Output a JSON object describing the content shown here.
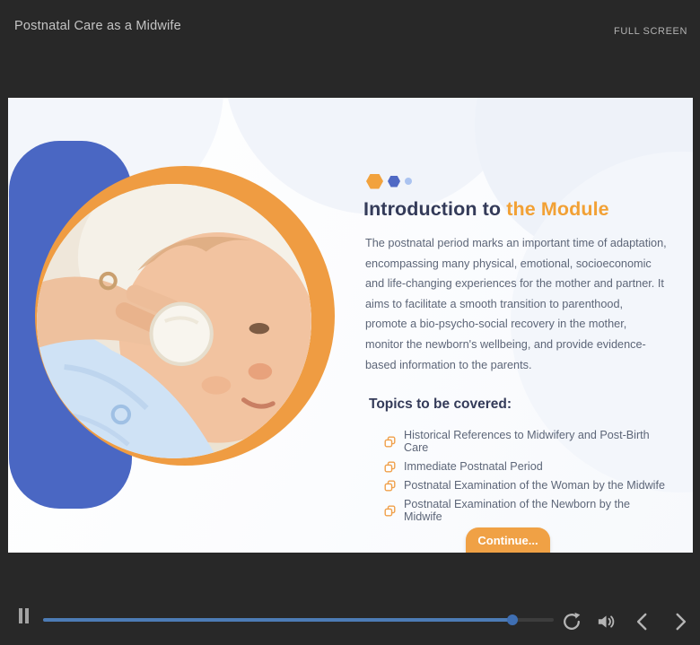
{
  "header": {
    "title": "Postnatal Care as a Midwife",
    "fullscreen_label": "FULL SCREEN"
  },
  "slide": {
    "heading": {
      "prefix": "Introduction to",
      "highlight": "the Module"
    },
    "body": "The postnatal period marks an important time of adaptation, encompassing many physical, emotional, socioeconomic and life-changing experiences for the mother and partner. It aims to facilitate a smooth transition to parenthood, promote a bio-psycho-social recovery in the mother, monitor the newborn's wellbeing, and provide evidence-based information to the parents.",
    "topics_heading": "Topics to be covered:",
    "topics": [
      "Historical References to Midwifery and Post-Birth Care",
      "Immediate Postnatal Period",
      "Postnatal Examination of the Woman by the Midwife",
      "Postnatal Examination of the Newborn by the Midwife"
    ],
    "continue_label": "Continue...",
    "photo_description": "adult hand cleaning a newborn baby's face with a cotton pad"
  },
  "player": {
    "progress_percent": 92,
    "controls": [
      "pause",
      "seek",
      "replay",
      "volume",
      "previous",
      "next"
    ]
  },
  "colors": {
    "chrome_bg": "#282828",
    "accent_orange": "#F0A145",
    "accent_blue": "#4A67C3",
    "heading_navy": "#343B59",
    "heading_orange": "#F2A135",
    "body_text": "#5D6678",
    "progress_blue": "#4D7CB6"
  }
}
